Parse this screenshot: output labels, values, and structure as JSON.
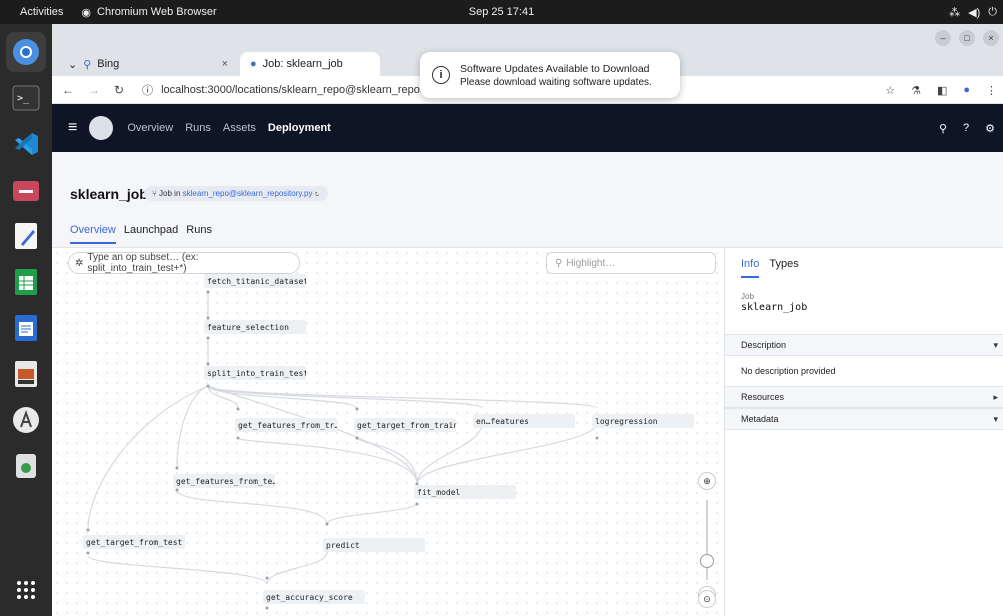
{
  "topbar": {
    "activities": "Activities",
    "app_name": "Chromium Web Browser",
    "clock": "Sep 25  17:41"
  },
  "dock": {
    "items": [
      {
        "name": "chromium",
        "num": "4"
      },
      {
        "name": "terminal",
        "num": "5"
      },
      {
        "name": "vscode",
        "num": "6"
      },
      {
        "name": "files",
        "num": "7"
      },
      {
        "name": "text-editor",
        "num": "8"
      },
      {
        "name": "calc",
        "num": "9"
      },
      {
        "name": "writer",
        "num": "10"
      },
      {
        "name": "impress",
        "num": "11"
      },
      {
        "name": "software",
        "num": "12"
      },
      {
        "name": "trash",
        "num": "13"
      },
      {
        "name": "apps-grid",
        "num": "14"
      }
    ]
  },
  "browser": {
    "tabs": [
      {
        "label": "Bing"
      },
      {
        "label": "Job: sklearn_job"
      }
    ],
    "url": "localhost:3000/locations/sklearn_repo@sklearn_repository.py/jobs/sklearn_job"
  },
  "notification": {
    "title": "Software Updates Available to Download",
    "body": "Please download waiting software updates."
  },
  "dagster_nav": {
    "links": [
      {
        "label": "Overview"
      },
      {
        "label": "Runs"
      },
      {
        "label": "Assets"
      },
      {
        "label": "Deployment"
      }
    ]
  },
  "job": {
    "title": "sklearn_job",
    "badge_prefix": "Job in",
    "badge_link": "sklearn_repo@sklearn_repository.py",
    "tabs": [
      {
        "label": "Overview"
      },
      {
        "label": "Launchpad"
      },
      {
        "label": "Runs"
      }
    ]
  },
  "graph": {
    "op_search_placeholder": "Type an op subset… (ex: split_into_train_test+*)",
    "highlight_placeholder": "Highlight…",
    "nodes": [
      {
        "label": "fetch_titanic_dataset"
      },
      {
        "label": "feature_selection"
      },
      {
        "label": "split_into_train_test"
      },
      {
        "label": "get_features_from_tr…"
      },
      {
        "label": "get_target_from_train"
      },
      {
        "label": "en…features"
      },
      {
        "label": "logregression"
      },
      {
        "label": "get_features_from_te…"
      },
      {
        "label": "fit_model"
      },
      {
        "label": "get_target_from_test"
      },
      {
        "label": "predict"
      },
      {
        "label": "get_accuracy_score"
      }
    ]
  },
  "panel": {
    "tabs": [
      {
        "label": "Info"
      },
      {
        "label": "Types"
      }
    ],
    "job_label": "Job",
    "job_name": "sklearn_job",
    "sections": {
      "description": "Description",
      "description_text": "No description provided",
      "resources": "Resources",
      "metadata": "Metadata"
    }
  }
}
